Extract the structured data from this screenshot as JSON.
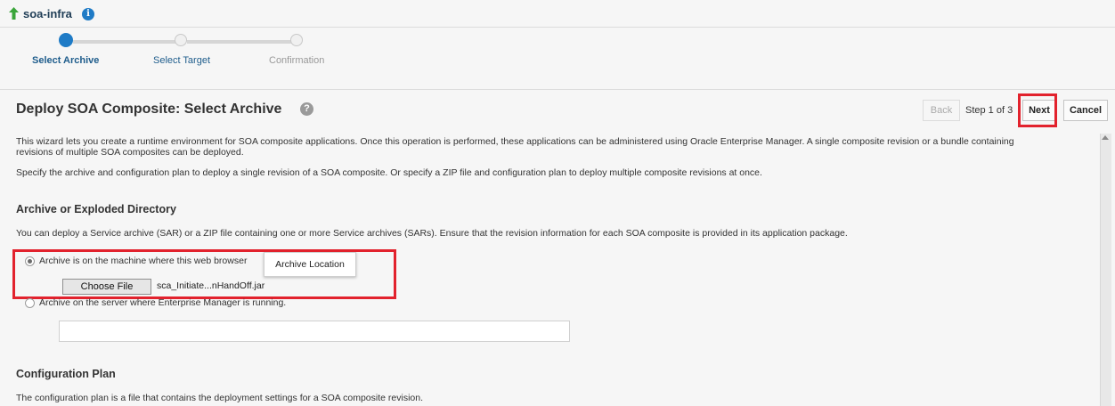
{
  "header": {
    "title": "soa-infra",
    "info_glyph": "i"
  },
  "train": {
    "stops": [
      {
        "label": "Select Archive",
        "state": "active"
      },
      {
        "label": "Select Target",
        "state": "link"
      },
      {
        "label": "Confirmation",
        "state": "disabled"
      }
    ]
  },
  "page": {
    "title": "Deploy SOA Composite: Select Archive",
    "help_glyph": "?"
  },
  "nav": {
    "back": "Back",
    "step": "Step 1 of 3",
    "next": "Next",
    "cancel": "Cancel"
  },
  "intro": {
    "line1": "This wizard lets you create a runtime environment for SOA composite applications. Once this operation is performed, these applications can be administered using Oracle Enterprise Manager. A single composite revision or a bundle containing",
    "line2": "revisions of multiple SOA composites can be deployed.",
    "line3": "Specify the archive and configuration plan to deploy a single revision of a SOA composite. Or specify a ZIP file and configuration plan to deploy multiple composite revisions at once."
  },
  "archive_section": {
    "heading": "Archive or Exploded Directory",
    "description": "You can deploy a Service archive (SAR) or a ZIP file containing one or more Service archives (SARs). Ensure that the revision information for each SOA composite is provided in its application package.",
    "option_local": "Archive is on the machine where this web browser",
    "tooltip": "Archive Location",
    "choose_file": "Choose File",
    "file_name": "sca_Initiate...nHandOff.jar",
    "option_server": "Archive on the server where Enterprise Manager is running.",
    "server_path_value": ""
  },
  "config_section": {
    "heading": "Configuration Plan",
    "description": "The configuration plan is a file that contains the deployment settings for a SOA composite revision."
  },
  "colors": {
    "accent": "#1f7bc6",
    "highlight": "#e2222d"
  }
}
